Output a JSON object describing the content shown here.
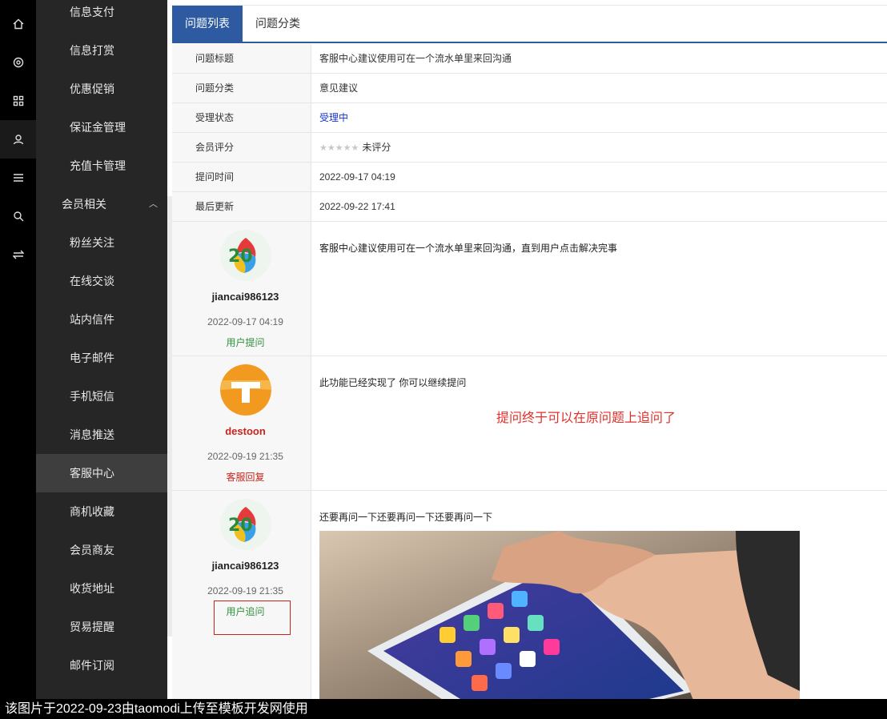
{
  "rail": {
    "icons": [
      "home-icon",
      "settings-icon",
      "grid-icon",
      "user-icon",
      "list-icon",
      "search-icon",
      "swap-icon"
    ]
  },
  "sidebar": {
    "items": [
      {
        "label": "信息支付"
      },
      {
        "label": "信息打赏"
      },
      {
        "label": "优惠促销"
      },
      {
        "label": "保证金管理"
      },
      {
        "label": "充值卡管理"
      },
      {
        "label": "会员相关",
        "group": true
      },
      {
        "label": "粉丝关注"
      },
      {
        "label": "在线交谈"
      },
      {
        "label": "站内信件"
      },
      {
        "label": "电子邮件"
      },
      {
        "label": "手机短信"
      },
      {
        "label": "消息推送"
      },
      {
        "label": "客服中心",
        "selected": true
      },
      {
        "label": "商机收藏"
      },
      {
        "label": "会员商友"
      },
      {
        "label": "收货地址"
      },
      {
        "label": "贸易提醒"
      },
      {
        "label": "邮件订阅"
      }
    ]
  },
  "tabs": [
    {
      "label": "问题列表",
      "active": true
    },
    {
      "label": "问题分类",
      "active": false
    }
  ],
  "info": [
    {
      "label": "问题标题",
      "value": "客服中心建议使用可在一个流水单里来回沟通"
    },
    {
      "label": "问题分类",
      "value": "意见建议"
    },
    {
      "label": "受理状态",
      "value": "受理中"
    },
    {
      "label": "会员评分",
      "stars": "★★★★★",
      "value": "未评分"
    },
    {
      "label": "提问时间",
      "value": "2022-09-17 04:19"
    },
    {
      "label": "最后更新",
      "value": "2022-09-22 17:41"
    }
  ],
  "messages": [
    {
      "user": "jiancai986123",
      "time": "2022-09-17 04:19",
      "tag": "用户提问",
      "text": "客服中心建议使用可在一个流水单里来回沟通，直到用户点击解决完事",
      "avatar_text": "20"
    },
    {
      "user": "destoon",
      "time": "2022-09-19 21:35",
      "tag": "客服回复",
      "text": "此功能已经实现了 你可以继续提问",
      "avatar_text": "T"
    },
    {
      "user": "jiancai986123",
      "time": "2022-09-19 21:35",
      "tag": "用户追问",
      "text": "还要再问一下还要再问一下还要再问一下",
      "avatar_text": "20"
    }
  ],
  "annotation": "提问终于可以在原问题上追问了",
  "footer": "该图片于2022-09-23由taomodi上传至模板开发网使用",
  "colors": {
    "accent": "#2d5aa0",
    "sidebar": "#262626",
    "rail": "#000000",
    "red": "#c8241c",
    "green": "#2f8f38"
  }
}
